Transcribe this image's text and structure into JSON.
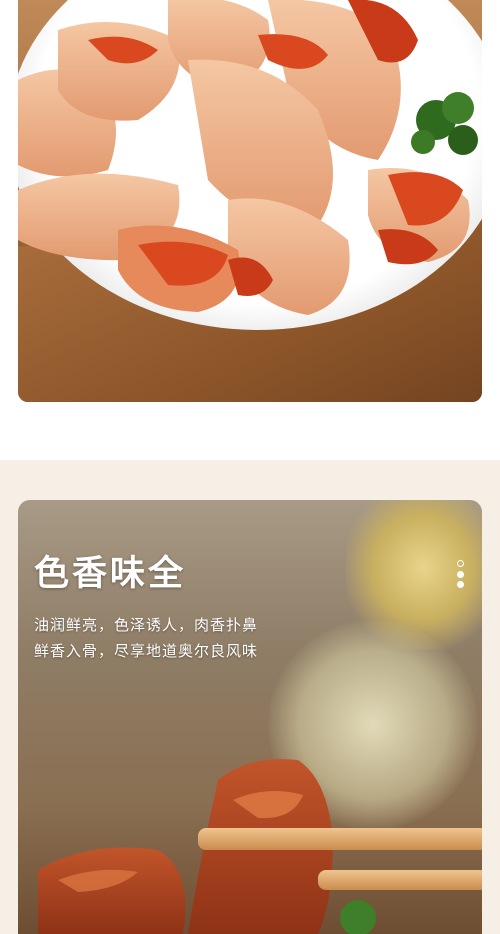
{
  "feature": {
    "heading": "色香味全",
    "description_line1": "油润鲜亮，色泽诱人，肉香扑鼻",
    "description_line2": "鲜香入骨，尽享地道奥尔良风味"
  },
  "colors": {
    "page_background": "#f6efe6",
    "text": "#ffffff",
    "chicken_sauce": "#d9481f",
    "chicken_skin": "#ecb48a"
  }
}
